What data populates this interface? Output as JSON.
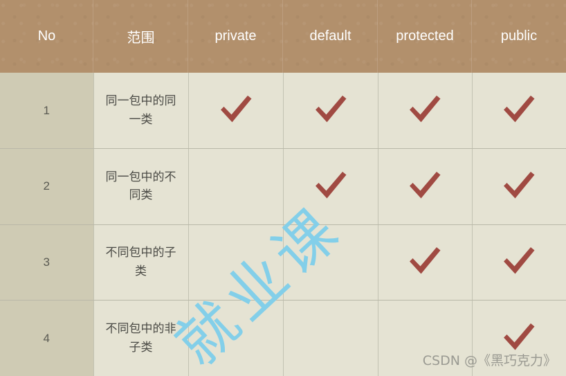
{
  "table": {
    "headers": [
      {
        "key": "no",
        "label": "No"
      },
      {
        "key": "scope",
        "label": "范围"
      },
      {
        "key": "private",
        "label": "private"
      },
      {
        "key": "default",
        "label": "default"
      },
      {
        "key": "protected",
        "label": "protected"
      },
      {
        "key": "public",
        "label": "public"
      }
    ],
    "rows": [
      {
        "no": "1",
        "scope": "同一包中的同一类",
        "private": true,
        "default": true,
        "protected": true,
        "public": true
      },
      {
        "no": "2",
        "scope": "同一包中的不同类",
        "private": false,
        "default": true,
        "protected": true,
        "public": true
      },
      {
        "no": "3",
        "scope": "不同包中的子类",
        "private": false,
        "default": false,
        "protected": true,
        "public": true
      },
      {
        "no": "4",
        "scope": "不同包中的非子类",
        "private": false,
        "default": false,
        "protected": false,
        "public": true
      }
    ]
  },
  "watermarks": {
    "diagonal": "就业课",
    "csdn": "CSDN @《黑巧克力》"
  },
  "colors": {
    "header_bg": "#b2906c",
    "header_text": "#ffffff",
    "cell_bg": "#e5e3d3",
    "no_cell_bg": "#cfcbb4",
    "cell_text": "#4a4a45",
    "check_mark": "#a04a42",
    "grid_line": "#c3c2b2",
    "watermark_diagonal": "#83cfe9",
    "watermark_csdn": "#9a9a92"
  },
  "icons": {
    "check": "check-mark-icon"
  }
}
